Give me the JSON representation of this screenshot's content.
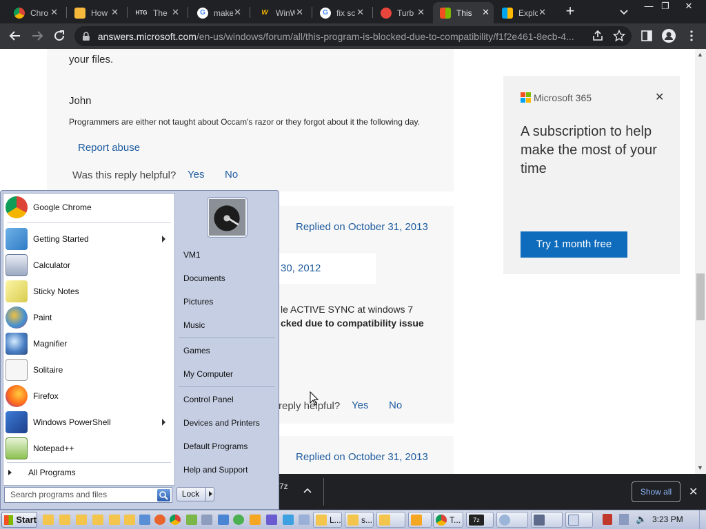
{
  "browser": {
    "tabs": [
      {
        "title": "Chro",
        "favicon": "chrome-tab-icon",
        "active": false
      },
      {
        "title": "How",
        "favicon": "emoji-tab-icon",
        "active": false
      },
      {
        "title": "The",
        "favicon": "htg-tab-icon",
        "favicon_text": "HTG",
        "active": false
      },
      {
        "title": "make",
        "favicon": "google-tab-icon",
        "active": false
      },
      {
        "title": "WinW",
        "favicon": "w-tab-icon",
        "favicon_text": "W",
        "active": false
      },
      {
        "title": "fix sc",
        "favicon": "google-tab-icon",
        "active": false
      },
      {
        "title": "Turb",
        "favicon": "turbo-tab-icon",
        "active": false
      },
      {
        "title": "This",
        "favicon": "microsoft-tab-icon",
        "active": true
      },
      {
        "title": "Explo",
        "favicon": "microsoft-tab-icon",
        "active": false
      }
    ],
    "url_host": "answers.microsoft.com",
    "url_path": "/en-us/windows/forum/all/this-program-is-blocked-due-to-compatibility/f1f2e461-8ecb-4..."
  },
  "page": {
    "top_text_partial": "your files.",
    "author": "John",
    "signature": "Programmers are either not taught about Occam's razor or they forgot about it the following day.",
    "report_abuse": "Report abuse",
    "helpful_question": "Was this reply helpful?",
    "helpful_question_partial": "reply helpful?",
    "yes": "Yes",
    "no": "No",
    "replied_1": "Replied on October 31, 2013",
    "date_partial": "30, 2012",
    "body_partial_1": "le ACTIVE SYNC at windows 7",
    "body_partial_2": "cked due to compatibility issue",
    "replied_2": "Replied on October 31, 2013"
  },
  "ad": {
    "brand": "Microsoft 365",
    "headline": "A subscription to help make the most of your time",
    "cta": "Try 1 month free"
  },
  "downloads": {
    "partial_item": "7z",
    "show_all": "Show all"
  },
  "start_menu": {
    "pinned": [
      {
        "label": "Google Chrome",
        "icon": "chrome-icon"
      }
    ],
    "recent": [
      {
        "label": "Getting Started",
        "icon": "getting-started-icon",
        "submenu": true
      },
      {
        "label": "Calculator",
        "icon": "calculator-icon",
        "submenu": false
      },
      {
        "label": "Sticky Notes",
        "icon": "sticky-notes-icon",
        "submenu": false
      },
      {
        "label": "Paint",
        "icon": "paint-icon",
        "submenu": false
      },
      {
        "label": "Magnifier",
        "icon": "magnifier-icon",
        "submenu": false
      },
      {
        "label": "Solitaire",
        "icon": "solitaire-icon",
        "submenu": false
      },
      {
        "label": "Firefox",
        "icon": "firefox-icon",
        "submenu": false
      },
      {
        "label": "Windows PowerShell",
        "icon": "powershell-icon",
        "submenu": true
      },
      {
        "label": "Notepad++",
        "icon": "notepadpp-icon",
        "submenu": false
      }
    ],
    "all_programs": "All Programs",
    "search_placeholder": "Search programs and files",
    "right": {
      "user": "VM1",
      "group1": [
        "Documents",
        "Pictures",
        "Music"
      ],
      "group2": [
        "Games",
        "My Computer"
      ],
      "group3": [
        "Control Panel",
        "Devices and Printers",
        "Default Programs",
        "Help and Support"
      ]
    },
    "lock": "Lock"
  },
  "taskbar": {
    "start": "Start",
    "buttons": [
      "L...",
      "s...",
      "",
      "",
      "T...",
      "7z",
      "",
      "",
      ""
    ],
    "clock": "3:23 PM"
  },
  "colors": {
    "link": "#1e5b9e",
    "cta": "#0f6cbd",
    "chrome_dark": "#202124"
  }
}
